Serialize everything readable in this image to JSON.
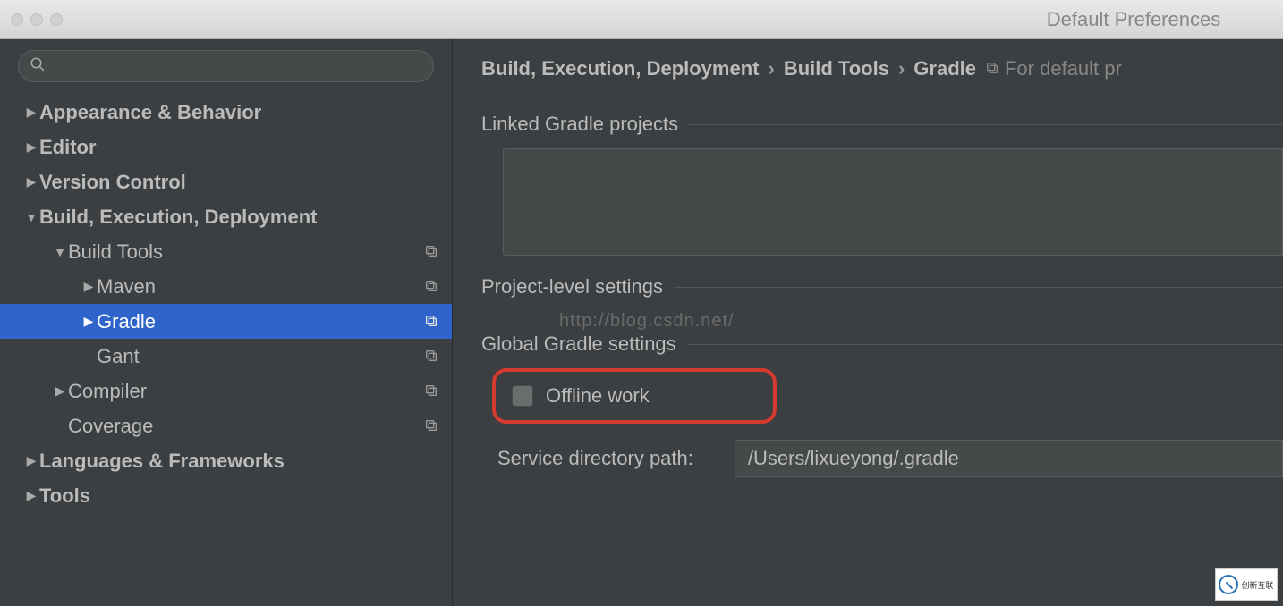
{
  "window": {
    "title": "Default Preferences"
  },
  "sidebar": {
    "search_placeholder": "",
    "items": [
      {
        "label": "Appearance & Behavior",
        "expanded": false,
        "indent": 0,
        "bold": true,
        "hasCopy": false
      },
      {
        "label": "Editor",
        "expanded": false,
        "indent": 0,
        "bold": true,
        "hasCopy": false
      },
      {
        "label": "Version Control",
        "expanded": false,
        "indent": 0,
        "bold": true,
        "hasCopy": false
      },
      {
        "label": "Build, Execution, Deployment",
        "expanded": true,
        "indent": 0,
        "bold": true,
        "hasCopy": false
      },
      {
        "label": "Build Tools",
        "expanded": true,
        "indent": 1,
        "bold": false,
        "hasCopy": true
      },
      {
        "label": "Maven",
        "expanded": false,
        "indent": 2,
        "bold": false,
        "hasCopy": true
      },
      {
        "label": "Gradle",
        "expanded": false,
        "indent": 2,
        "bold": false,
        "hasCopy": true,
        "selected": true
      },
      {
        "label": "Gant",
        "expanded": null,
        "indent": 2,
        "bold": false,
        "hasCopy": true
      },
      {
        "label": "Compiler",
        "expanded": false,
        "indent": 1,
        "bold": false,
        "hasCopy": true
      },
      {
        "label": "Coverage",
        "expanded": null,
        "indent": 1,
        "bold": false,
        "hasCopy": true
      },
      {
        "label": "Languages & Frameworks",
        "expanded": false,
        "indent": 0,
        "bold": true,
        "hasCopy": false
      },
      {
        "label": "Tools",
        "expanded": false,
        "indent": 0,
        "bold": true,
        "hasCopy": false
      }
    ]
  },
  "content": {
    "breadcrumb": [
      "Build, Execution, Deployment",
      "Build Tools",
      "Gradle"
    ],
    "breadcrumb_suffix": "For default pr",
    "sections": {
      "linked": "Linked Gradle projects",
      "project": "Project-level settings",
      "global": "Global Gradle settings"
    },
    "offline_work_label": "Offline work",
    "service_dir_label": "Service directory path:",
    "service_dir_value": "/Users/lixueyong/.gradle"
  },
  "watermark": "http://blog.csdn.net/",
  "logo_text": "创新互联"
}
